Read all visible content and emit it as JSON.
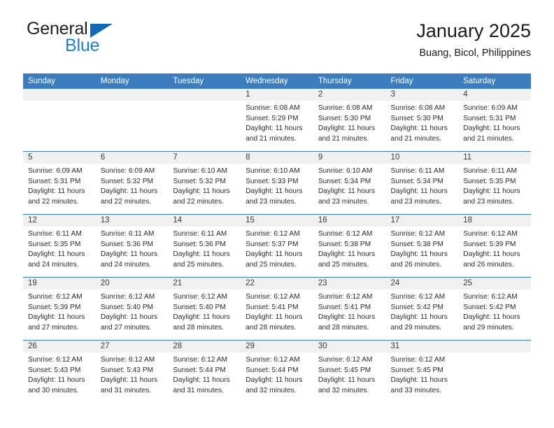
{
  "brand": {
    "line1": "General",
    "line2": "Blue",
    "triangle_color": "#1268b3",
    "blue_text_color": "#1f7fc4"
  },
  "header": {
    "month_title": "January 2025",
    "location": "Buang, Bicol, Philippines"
  },
  "theme": {
    "header_row_bg": "#3b7dbf",
    "header_row_text": "#ffffff",
    "daynum_band_bg": "#f0f0f0",
    "week_separator": "#3b7dbf",
    "body_text": "#2b2b2b"
  },
  "calendar": {
    "weekday_headers": [
      "Sunday",
      "Monday",
      "Tuesday",
      "Wednesday",
      "Thursday",
      "Friday",
      "Saturday"
    ],
    "weeks": [
      [
        {
          "day": "",
          "empty": true,
          "sunrise": "",
          "sunset": "",
          "daylight_line1": "",
          "daylight_line2": ""
        },
        {
          "day": "",
          "empty": true,
          "sunrise": "",
          "sunset": "",
          "daylight_line1": "",
          "daylight_line2": ""
        },
        {
          "day": "",
          "empty": true,
          "sunrise": "",
          "sunset": "",
          "daylight_line1": "",
          "daylight_line2": ""
        },
        {
          "day": "1",
          "empty": false,
          "sunrise": "Sunrise: 6:08 AM",
          "sunset": "Sunset: 5:29 PM",
          "daylight_line1": "Daylight: 11 hours",
          "daylight_line2": "and 21 minutes."
        },
        {
          "day": "2",
          "empty": false,
          "sunrise": "Sunrise: 6:08 AM",
          "sunset": "Sunset: 5:30 PM",
          "daylight_line1": "Daylight: 11 hours",
          "daylight_line2": "and 21 minutes."
        },
        {
          "day": "3",
          "empty": false,
          "sunrise": "Sunrise: 6:08 AM",
          "sunset": "Sunset: 5:30 PM",
          "daylight_line1": "Daylight: 11 hours",
          "daylight_line2": "and 21 minutes."
        },
        {
          "day": "4",
          "empty": false,
          "sunrise": "Sunrise: 6:09 AM",
          "sunset": "Sunset: 5:31 PM",
          "daylight_line1": "Daylight: 11 hours",
          "daylight_line2": "and 21 minutes."
        }
      ],
      [
        {
          "day": "5",
          "empty": false,
          "sunrise": "Sunrise: 6:09 AM",
          "sunset": "Sunset: 5:31 PM",
          "daylight_line1": "Daylight: 11 hours",
          "daylight_line2": "and 22 minutes."
        },
        {
          "day": "6",
          "empty": false,
          "sunrise": "Sunrise: 6:09 AM",
          "sunset": "Sunset: 5:32 PM",
          "daylight_line1": "Daylight: 11 hours",
          "daylight_line2": "and 22 minutes."
        },
        {
          "day": "7",
          "empty": false,
          "sunrise": "Sunrise: 6:10 AM",
          "sunset": "Sunset: 5:32 PM",
          "daylight_line1": "Daylight: 11 hours",
          "daylight_line2": "and 22 minutes."
        },
        {
          "day": "8",
          "empty": false,
          "sunrise": "Sunrise: 6:10 AM",
          "sunset": "Sunset: 5:33 PM",
          "daylight_line1": "Daylight: 11 hours",
          "daylight_line2": "and 23 minutes."
        },
        {
          "day": "9",
          "empty": false,
          "sunrise": "Sunrise: 6:10 AM",
          "sunset": "Sunset: 5:34 PM",
          "daylight_line1": "Daylight: 11 hours",
          "daylight_line2": "and 23 minutes."
        },
        {
          "day": "10",
          "empty": false,
          "sunrise": "Sunrise: 6:11 AM",
          "sunset": "Sunset: 5:34 PM",
          "daylight_line1": "Daylight: 11 hours",
          "daylight_line2": "and 23 minutes."
        },
        {
          "day": "11",
          "empty": false,
          "sunrise": "Sunrise: 6:11 AM",
          "sunset": "Sunset: 5:35 PM",
          "daylight_line1": "Daylight: 11 hours",
          "daylight_line2": "and 23 minutes."
        }
      ],
      [
        {
          "day": "12",
          "empty": false,
          "sunrise": "Sunrise: 6:11 AM",
          "sunset": "Sunset: 5:35 PM",
          "daylight_line1": "Daylight: 11 hours",
          "daylight_line2": "and 24 minutes."
        },
        {
          "day": "13",
          "empty": false,
          "sunrise": "Sunrise: 6:11 AM",
          "sunset": "Sunset: 5:36 PM",
          "daylight_line1": "Daylight: 11 hours",
          "daylight_line2": "and 24 minutes."
        },
        {
          "day": "14",
          "empty": false,
          "sunrise": "Sunrise: 6:11 AM",
          "sunset": "Sunset: 5:36 PM",
          "daylight_line1": "Daylight: 11 hours",
          "daylight_line2": "and 25 minutes."
        },
        {
          "day": "15",
          "empty": false,
          "sunrise": "Sunrise: 6:12 AM",
          "sunset": "Sunset: 5:37 PM",
          "daylight_line1": "Daylight: 11 hours",
          "daylight_line2": "and 25 minutes."
        },
        {
          "day": "16",
          "empty": false,
          "sunrise": "Sunrise: 6:12 AM",
          "sunset": "Sunset: 5:38 PM",
          "daylight_line1": "Daylight: 11 hours",
          "daylight_line2": "and 25 minutes."
        },
        {
          "day": "17",
          "empty": false,
          "sunrise": "Sunrise: 6:12 AM",
          "sunset": "Sunset: 5:38 PM",
          "daylight_line1": "Daylight: 11 hours",
          "daylight_line2": "and 26 minutes."
        },
        {
          "day": "18",
          "empty": false,
          "sunrise": "Sunrise: 6:12 AM",
          "sunset": "Sunset: 5:39 PM",
          "daylight_line1": "Daylight: 11 hours",
          "daylight_line2": "and 26 minutes."
        }
      ],
      [
        {
          "day": "19",
          "empty": false,
          "sunrise": "Sunrise: 6:12 AM",
          "sunset": "Sunset: 5:39 PM",
          "daylight_line1": "Daylight: 11 hours",
          "daylight_line2": "and 27 minutes."
        },
        {
          "day": "20",
          "empty": false,
          "sunrise": "Sunrise: 6:12 AM",
          "sunset": "Sunset: 5:40 PM",
          "daylight_line1": "Daylight: 11 hours",
          "daylight_line2": "and 27 minutes."
        },
        {
          "day": "21",
          "empty": false,
          "sunrise": "Sunrise: 6:12 AM",
          "sunset": "Sunset: 5:40 PM",
          "daylight_line1": "Daylight: 11 hours",
          "daylight_line2": "and 28 minutes."
        },
        {
          "day": "22",
          "empty": false,
          "sunrise": "Sunrise: 6:12 AM",
          "sunset": "Sunset: 5:41 PM",
          "daylight_line1": "Daylight: 11 hours",
          "daylight_line2": "and 28 minutes."
        },
        {
          "day": "23",
          "empty": false,
          "sunrise": "Sunrise: 6:12 AM",
          "sunset": "Sunset: 5:41 PM",
          "daylight_line1": "Daylight: 11 hours",
          "daylight_line2": "and 28 minutes."
        },
        {
          "day": "24",
          "empty": false,
          "sunrise": "Sunrise: 6:12 AM",
          "sunset": "Sunset: 5:42 PM",
          "daylight_line1": "Daylight: 11 hours",
          "daylight_line2": "and 29 minutes."
        },
        {
          "day": "25",
          "empty": false,
          "sunrise": "Sunrise: 6:12 AM",
          "sunset": "Sunset: 5:42 PM",
          "daylight_line1": "Daylight: 11 hours",
          "daylight_line2": "and 29 minutes."
        }
      ],
      [
        {
          "day": "26",
          "empty": false,
          "sunrise": "Sunrise: 6:12 AM",
          "sunset": "Sunset: 5:43 PM",
          "daylight_line1": "Daylight: 11 hours",
          "daylight_line2": "and 30 minutes."
        },
        {
          "day": "27",
          "empty": false,
          "sunrise": "Sunrise: 6:12 AM",
          "sunset": "Sunset: 5:43 PM",
          "daylight_line1": "Daylight: 11 hours",
          "daylight_line2": "and 31 minutes."
        },
        {
          "day": "28",
          "empty": false,
          "sunrise": "Sunrise: 6:12 AM",
          "sunset": "Sunset: 5:44 PM",
          "daylight_line1": "Daylight: 11 hours",
          "daylight_line2": "and 31 minutes."
        },
        {
          "day": "29",
          "empty": false,
          "sunrise": "Sunrise: 6:12 AM",
          "sunset": "Sunset: 5:44 PM",
          "daylight_line1": "Daylight: 11 hours",
          "daylight_line2": "and 32 minutes."
        },
        {
          "day": "30",
          "empty": false,
          "sunrise": "Sunrise: 6:12 AM",
          "sunset": "Sunset: 5:45 PM",
          "daylight_line1": "Daylight: 11 hours",
          "daylight_line2": "and 32 minutes."
        },
        {
          "day": "31",
          "empty": false,
          "sunrise": "Sunrise: 6:12 AM",
          "sunset": "Sunset: 5:45 PM",
          "daylight_line1": "Daylight: 11 hours",
          "daylight_line2": "and 33 minutes."
        },
        {
          "day": "",
          "empty": true,
          "sunrise": "",
          "sunset": "",
          "daylight_line1": "",
          "daylight_line2": ""
        }
      ]
    ]
  }
}
